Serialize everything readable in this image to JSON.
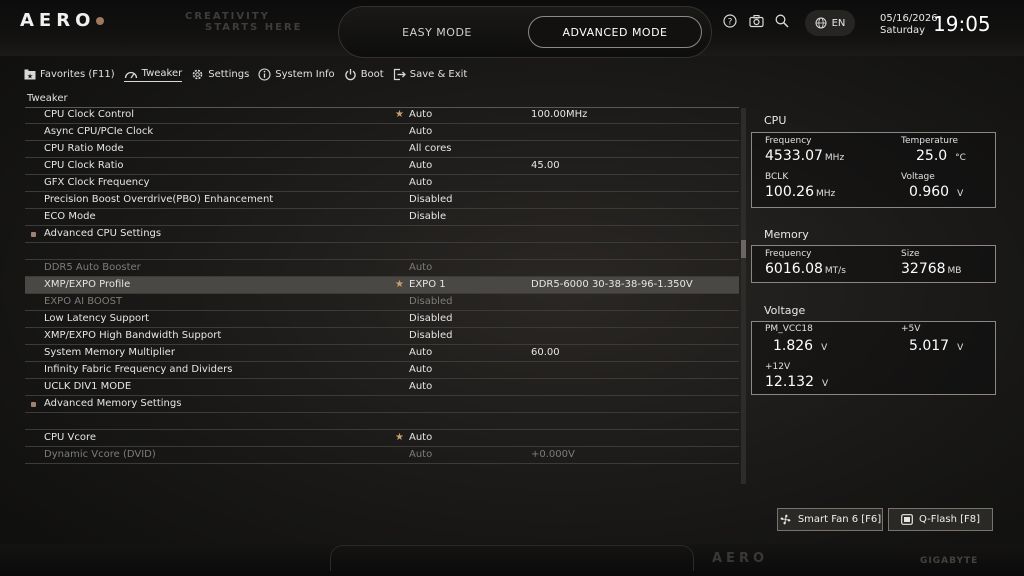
{
  "header": {
    "logo": "AERO",
    "slogan_line1": "CREATIVITY",
    "slogan_line2": "STARTS HERE",
    "easy_mode": "EASY MODE",
    "advanced_mode": "ADVANCED MODE",
    "language": "EN",
    "date": "05/16/2026",
    "weekday": "Saturday",
    "time": "19:05"
  },
  "nav": {
    "favorites": "Favorites (F11)",
    "tweaker": "Tweaker",
    "settings": "Settings",
    "system_info": "System Info",
    "boot": "Boot",
    "save_exit": "Save & Exit",
    "active": "tweaker"
  },
  "section_title": "Tweaker",
  "rows": [
    {
      "label": "CPU Clock Control",
      "value": "Auto",
      "extra": "100.00MHz",
      "star": true
    },
    {
      "label": "Async CPU/PCIe Clock",
      "value": "Auto"
    },
    {
      "label": "CPU Ratio Mode",
      "value": "All cores"
    },
    {
      "label": "CPU Clock Ratio",
      "value": "Auto",
      "extra": "45.00"
    },
    {
      "label": "GFX Clock Frequency",
      "value": "Auto"
    },
    {
      "label": "Precision Boost Overdrive(PBO) Enhancement",
      "value": "Disabled"
    },
    {
      "label": "ECO Mode",
      "value": "Disable"
    },
    {
      "label": "Advanced CPU Settings",
      "submenu": true
    },
    {
      "blank": true
    },
    {
      "label": "DDR5 Auto Booster",
      "value": "Auto",
      "dim": true
    },
    {
      "label": "XMP/EXPO Profile",
      "value": "EXPO 1",
      "extra": "DDR5-6000 30-38-38-96-1.350V",
      "star": true,
      "selected": true
    },
    {
      "label": "EXPO AI BOOST",
      "value": "Disabled",
      "dim": true
    },
    {
      "label": "Low Latency Support",
      "value": "Disabled"
    },
    {
      "label": "XMP/EXPO High Bandwidth Support",
      "value": "Disabled"
    },
    {
      "label": "System Memory Multiplier",
      "value": "Auto",
      "extra": "60.00"
    },
    {
      "label": "Infinity Fabric Frequency and Dividers",
      "value": "Auto"
    },
    {
      "label": "UCLK DIV1 MODE",
      "value": "Auto"
    },
    {
      "label": "Advanced Memory Settings",
      "submenu": true
    },
    {
      "blank": true
    },
    {
      "label": "CPU Vcore",
      "value": "Auto",
      "star": true
    },
    {
      "label": "Dynamic Vcore (DVID)",
      "value": "Auto",
      "extra": "+0.000V",
      "dim": true
    }
  ],
  "cpu": {
    "title": "CPU",
    "freq_label": "Frequency",
    "freq_value": "4533.07",
    "freq_unit": "MHz",
    "temp_label": "Temperature",
    "temp_value": "25.0",
    "temp_unit": "°C",
    "bclk_label": "BCLK",
    "bclk_value": "100.26",
    "bclk_unit": "MHz",
    "volt_label": "Voltage",
    "volt_value": "0.960",
    "volt_unit": "V"
  },
  "memory": {
    "title": "Memory",
    "freq_label": "Frequency",
    "freq_value": "6016.08",
    "freq_unit": "MT/s",
    "size_label": "Size",
    "size_value": "32768",
    "size_unit": "MB"
  },
  "voltage": {
    "title": "Voltage",
    "vcc18_label": "PM_VCC18",
    "vcc18_value": "1.826",
    "vcc18_unit": "V",
    "v5_label": "+5V",
    "v5_value": "5.017",
    "v5_unit": "V",
    "v12_label": "+12V",
    "v12_value": "12.132",
    "v12_unit": "V"
  },
  "footer": {
    "smart_fan": "Smart Fan 6 [F6]",
    "qflash": "Q-Flash [F8]",
    "bottom_logo": "AERO",
    "brand": "GIGABYTE"
  },
  "colors": {
    "accent_star": "#c8a06a",
    "selected_row": "#4a4845",
    "dim_text": "#7e7c79"
  }
}
